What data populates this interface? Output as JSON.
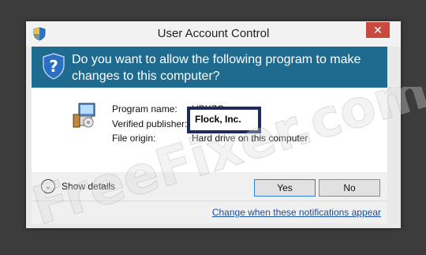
{
  "window": {
    "title": "User Account Control",
    "close_label": "✕"
  },
  "banner": {
    "question": "Do you want to allow the following program to make changes to this computer?"
  },
  "details": {
    "program_name_label": "Program name:",
    "program_name_value": "UPXZC",
    "verified_publisher_label": "Verified publisher:",
    "verified_publisher_value": "Flock, Inc.",
    "file_origin_label": "File origin:",
    "file_origin_value": "Hard drive on this computer"
  },
  "controls": {
    "show_details_label": "Show details",
    "yes_label": "Yes",
    "no_label": "No"
  },
  "footer": {
    "link_label": "Change when these notifications appear"
  },
  "watermark": {
    "text": "FreeFixer.com"
  },
  "colors": {
    "banner": "#1e6b8f",
    "close": "#c84a3f",
    "publisher_box_border": "#1d2c5c",
    "link": "#1a4f9c"
  }
}
